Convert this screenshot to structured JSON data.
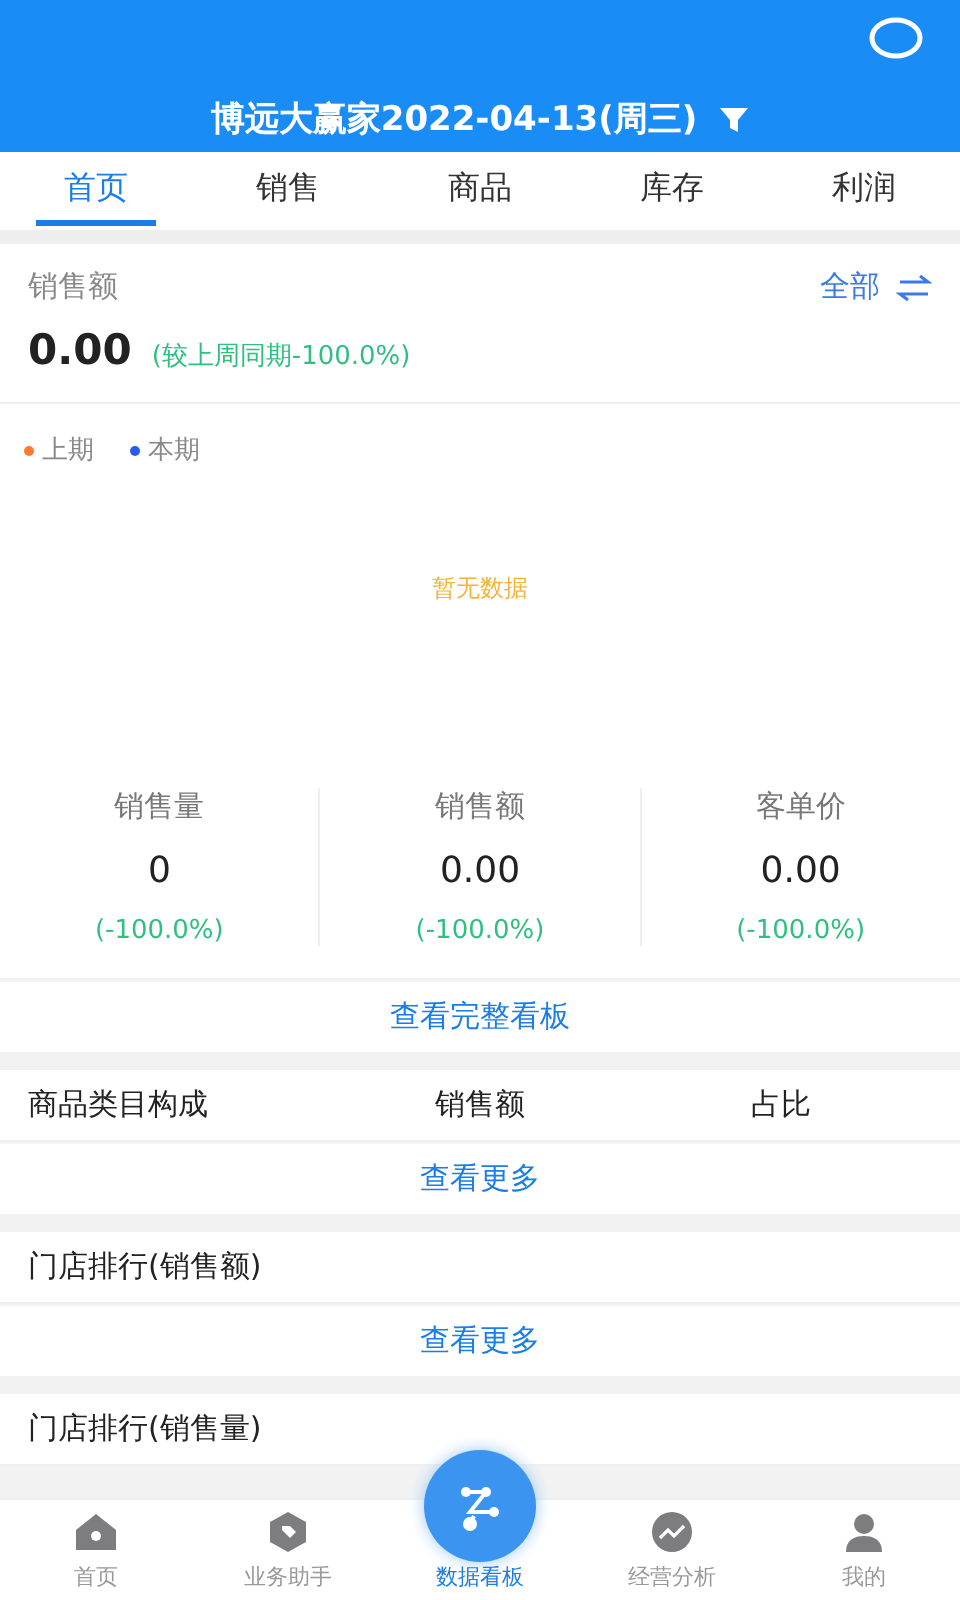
{
  "header": {
    "title": "博远大赢家2022-04-13(周三)"
  },
  "tabs": [
    {
      "label": "首页",
      "selected": true
    },
    {
      "label": "销售",
      "selected": false
    },
    {
      "label": "商品",
      "selected": false
    },
    {
      "label": "库存",
      "selected": false
    },
    {
      "label": "利润",
      "selected": false
    }
  ],
  "sales": {
    "label": "销售额",
    "scope": "全部",
    "value": "0.00",
    "compare": "(较上周同期-100.0%)",
    "legend": [
      {
        "label": "上期",
        "color": "#ff7a2e"
      },
      {
        "label": "本期",
        "color": "#2a5bf0"
      }
    ],
    "empty": "暂无数据",
    "metrics": [
      {
        "label": "销售量",
        "value": "0",
        "change": "(-100.0%)"
      },
      {
        "label": "销售额",
        "value": "0.00",
        "change": "(-100.0%)"
      },
      {
        "label": "客单价",
        "value": "0.00",
        "change": "(-100.0%)"
      }
    ],
    "link": "查看完整看板"
  },
  "category": {
    "columns": [
      "商品类目构成",
      "销售额",
      "占比"
    ],
    "link": "查看更多"
  },
  "store_rank_amount": {
    "title": "门店排行(销售额)",
    "link": "查看更多"
  },
  "store_rank_qty": {
    "title": "门店排行(销售量)"
  },
  "nav": [
    {
      "label": "首页",
      "selected": false
    },
    {
      "label": "业务助手",
      "selected": false
    },
    {
      "label": "数据看板",
      "selected": true
    },
    {
      "label": "经营分析",
      "selected": false
    },
    {
      "label": "我的",
      "selected": false
    }
  ]
}
